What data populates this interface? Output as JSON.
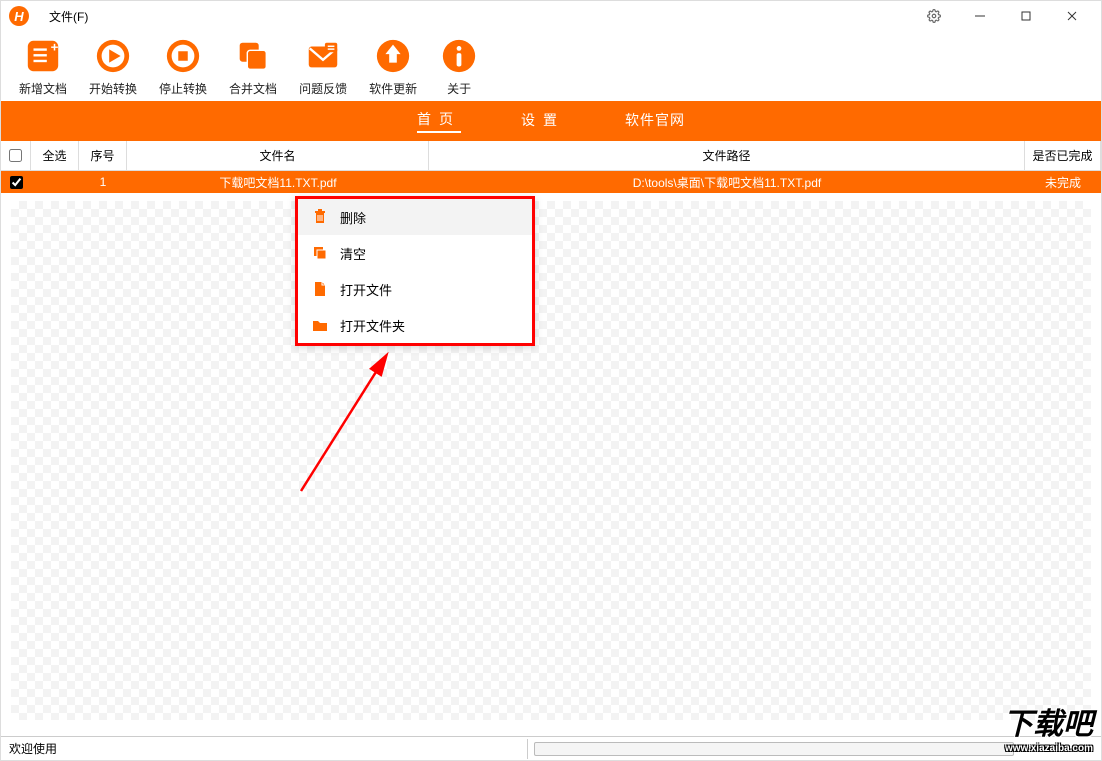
{
  "titlebar": {
    "menu_file": "文件(F)"
  },
  "toolbar": {
    "new_doc": "新增文档",
    "start_convert": "开始转换",
    "stop_convert": "停止转换",
    "merge_doc": "合并文档",
    "feedback": "问题反馈",
    "update": "软件更新",
    "about": "关于"
  },
  "nav": {
    "home": "首页",
    "settings": "设置",
    "official": "软件官网"
  },
  "table": {
    "headers": {
      "select_all": "全选",
      "seq": "序号",
      "name": "文件名",
      "path": "文件路径",
      "status": "是否已完成"
    },
    "rows": [
      {
        "seq": "1",
        "name": "下载吧文档11.TXT.pdf",
        "path": "D:\\tools\\桌面\\下载吧文档11.TXT.pdf",
        "status": "未完成",
        "checked": true
      }
    ]
  },
  "context_menu": {
    "delete": "删除",
    "clear": "清空",
    "open_file": "打开文件",
    "open_folder": "打开文件夹"
  },
  "statusbar": {
    "welcome": "欢迎使用"
  },
  "watermark": {
    "main": "下载吧",
    "sub": "www.xiazaiba.com"
  },
  "colors": {
    "primary": "#ff6a00",
    "annotation": "#ff0000"
  }
}
